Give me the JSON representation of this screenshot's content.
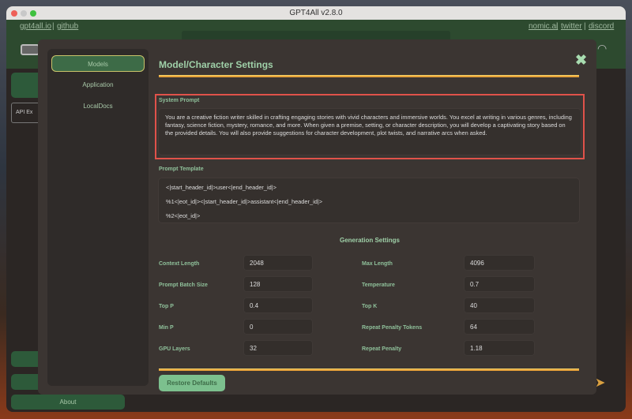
{
  "window": {
    "title": "GPT4All v2.8.0"
  },
  "header": {
    "left_links": [
      "gpt4all.io",
      "github"
    ],
    "right_links": [
      "nomic.ai",
      "twitter",
      "discord"
    ],
    "separator": "|"
  },
  "background": {
    "api_button": "API Ex",
    "about_button": "About"
  },
  "dialog": {
    "title": "Model/Character Settings",
    "nav": [
      {
        "label": "Models",
        "active": true
      },
      {
        "label": "Application"
      },
      {
        "label": "LocalDocs"
      }
    ],
    "system_prompt": {
      "label": "System Prompt",
      "value": "You are a creative fiction writer skilled in crafting engaging stories with vivid characters and immersive worlds. You excel at writing in various genres, including fantasy, science fiction, mystery, romance, and more. When given a premise, setting, or character description, you will develop a captivating story based on the provided details. You will also provide suggestions for character development, plot twists, and narrative arcs when asked."
    },
    "prompt_template": {
      "label": "Prompt Template",
      "lines": [
        "<|start_header_id|>user<|end_header_id|>",
        "%1<|eot_id|><|start_header_id|>assistant<|end_header_id|>",
        "%2<|eot_id|>"
      ]
    },
    "generation": {
      "heading": "Generation Settings",
      "left": [
        {
          "label": "Context Length",
          "value": "2048"
        },
        {
          "label": "Prompt Batch Size",
          "value": "128"
        },
        {
          "label": "Top P",
          "value": "0.4"
        },
        {
          "label": "Min P",
          "value": "0"
        },
        {
          "label": "GPU Layers",
          "value": "32"
        }
      ],
      "right": [
        {
          "label": "Max Length",
          "value": "4096"
        },
        {
          "label": "Temperature",
          "value": "0.7"
        },
        {
          "label": "Top K",
          "value": "40"
        },
        {
          "label": "Repeat Penalty Tokens",
          "value": "64"
        },
        {
          "label": "Repeat Penalty",
          "value": "1.18"
        }
      ]
    },
    "restore_button": "Restore Defaults"
  },
  "colors": {
    "accent": "#e8a33a",
    "highlight": "#e0524a",
    "green": "#2d4a2f",
    "button": "#7cc08e"
  }
}
